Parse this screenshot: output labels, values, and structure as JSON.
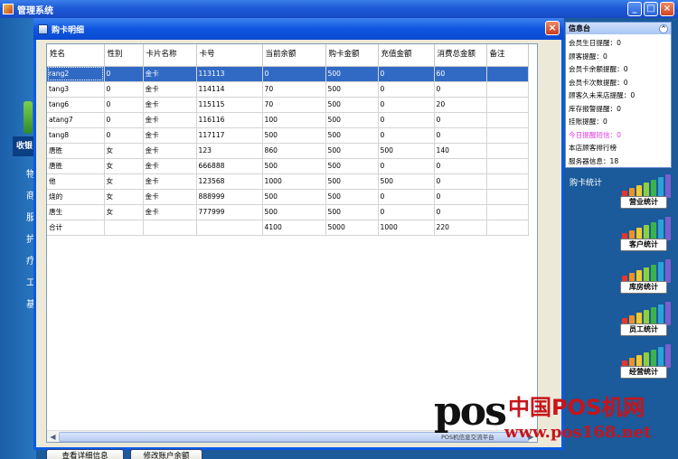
{
  "app": {
    "title": "管理系统"
  },
  "left_nav": {
    "active": "收银",
    "items": [
      "物",
      "商",
      "服",
      "护",
      "疗",
      "工",
      "基"
    ]
  },
  "dialog": {
    "title": "购卡明细",
    "columns": [
      "姓名",
      "性别",
      "卡片名称",
      "卡号",
      "当前余额",
      "购卡金额",
      "充值金额",
      "消费总金额",
      "备注"
    ],
    "rows": [
      [
        "rang2",
        "0",
        "金卡",
        "113113",
        "0",
        "500",
        "0",
        "60",
        ""
      ],
      [
        "tang3",
        "0",
        "金卡",
        "114114",
        "70",
        "500",
        "0",
        "0",
        ""
      ],
      [
        "tang6",
        "0",
        "金卡",
        "115115",
        "70",
        "500",
        "0",
        "20",
        ""
      ],
      [
        "atang7",
        "0",
        "金卡",
        "116116",
        "100",
        "500",
        "0",
        "0",
        ""
      ],
      [
        "tang8",
        "0",
        "金卡",
        "117117",
        "500",
        "500",
        "0",
        "0",
        ""
      ],
      [
        "唐胜",
        "女",
        "金卡",
        "123",
        "860",
        "500",
        "500",
        "140",
        ""
      ],
      [
        "唐胜",
        "女",
        "金卡",
        "666888",
        "500",
        "500",
        "0",
        "0",
        ""
      ],
      [
        "他",
        "女",
        "金卡",
        "123568",
        "1000",
        "500",
        "500",
        "0",
        ""
      ],
      [
        "烧的",
        "女",
        "金卡",
        "888999",
        "500",
        "500",
        "0",
        "0",
        ""
      ],
      [
        "唐生",
        "女",
        "金卡",
        "777999",
        "500",
        "500",
        "0",
        "0",
        ""
      ],
      [
        "合计",
        "",
        "",
        "",
        "4100",
        "5000",
        "1000",
        "220",
        ""
      ]
    ],
    "selected_row": 0,
    "buttons": {
      "details": "查看详细信息",
      "modify_balance": "修改账户余额"
    }
  },
  "info_panel": {
    "title": "信息台",
    "items": [
      {
        "text": "会员生日提醒：0",
        "color": "#000000"
      },
      {
        "text": "顾客提醒：0",
        "color": "#000000"
      },
      {
        "text": "会员卡余额提醒：0",
        "color": "#000000"
      },
      {
        "text": "会员卡次数提醒：0",
        "color": "#000000"
      },
      {
        "text": "顾客久未来店提醒：0",
        "color": "#000000"
      },
      {
        "text": "库存报警提醒：0",
        "color": "#000000"
      },
      {
        "text": "挂账提醒：0",
        "color": "#000000"
      },
      {
        "text": "今日提醒短信：0",
        "color": "#e03ae0"
      },
      {
        "text": "本店顾客排行榜",
        "color": "#000000"
      },
      {
        "text": "服务器信息：18",
        "color": "#000000"
      }
    ]
  },
  "stats": {
    "label": "购卡统计",
    "buttons": [
      "营业统计",
      "客户统计",
      "库房统计",
      "员工统计",
      "经营统计"
    ]
  },
  "watermark": {
    "logo": "pos",
    "cn": "中国POS机网",
    "url": "www.pos168.net",
    "sub": "POS机信息交流平台"
  }
}
